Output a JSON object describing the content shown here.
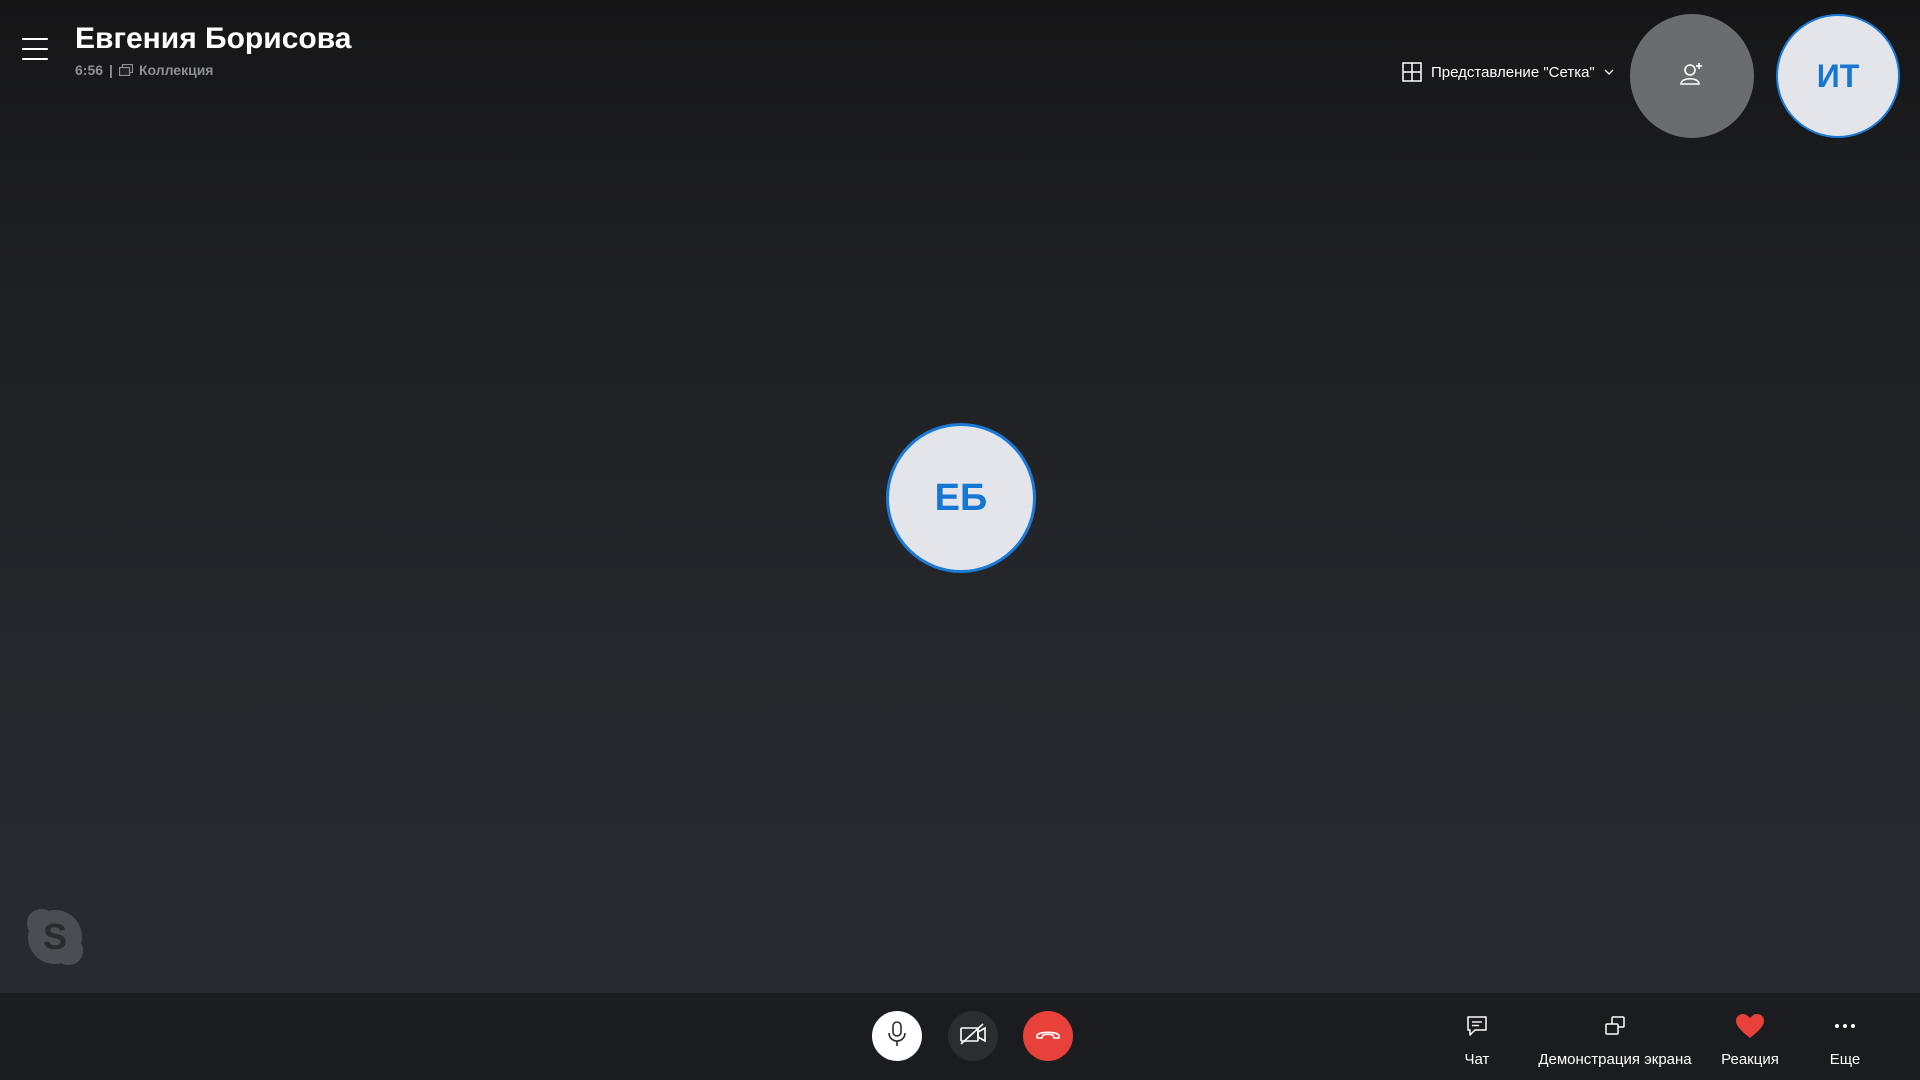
{
  "header": {
    "title": "Евгения Борисова",
    "duration": "6:56",
    "separator": "|",
    "collection_label": "Коллекция",
    "view_toggle_label": "Представление \"Сетка\"",
    "self_initials": "ИТ"
  },
  "main": {
    "participant_initials": "ЕБ"
  },
  "bottom_bar": {
    "chat_label": "Чат",
    "share_label": "Демонстрация экрана",
    "reaction_label": "Реакция",
    "more_label": "Еще"
  },
  "colors": {
    "accent": "#1a7ad8",
    "end_call": "#e8413a",
    "reaction_heart": "#e8413a"
  },
  "icons": {
    "menu": "hamburger-icon",
    "collection": "gallery-icon",
    "grid": "grid-icon",
    "chevron": "chevron-down-icon",
    "add_person": "add-person-icon",
    "skype": "skype-logo",
    "mic": "microphone-icon",
    "camera_off": "camera-off-icon",
    "hangup": "end-call-icon",
    "chat": "chat-icon",
    "share": "share-screen-icon",
    "reaction": "heart-icon",
    "more": "more-icon"
  }
}
